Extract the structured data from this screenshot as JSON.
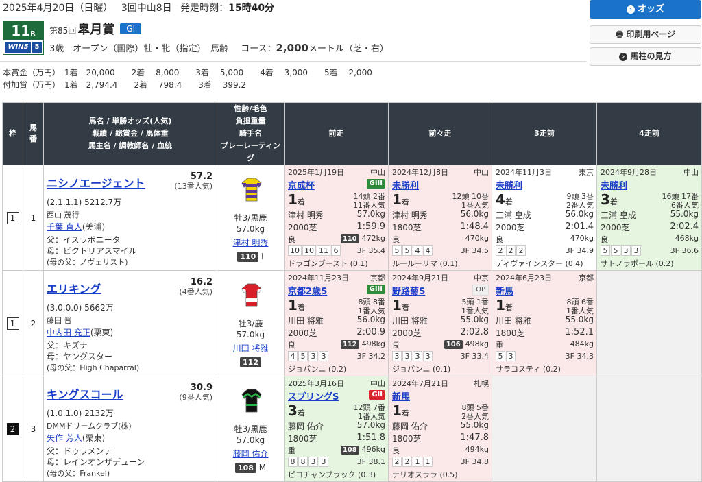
{
  "header": {
    "date": "2025年4月20日（日曜）",
    "meet": "3回中山8日",
    "post_label": "発走時刻：",
    "post_time": "15時40分",
    "race_no": "11",
    "race_no_suffix": "R",
    "logo_text": "WIN5",
    "logo_num": "5",
    "kai": "第85回",
    "race_name": "皐月賞",
    "grade": "GI",
    "conditions": "3歳　オープン（国際）牡・牝（指定）　馬齢",
    "course_label": "コース：",
    "distance": "2,000",
    "distance_unit": "メートル（芝・右）",
    "prize_main": "本賞金（万円）　1着　20,000　　2着　 8,000　　3着　 5,000　　4着　 3,000　　5着　 2,000",
    "prize_add": "付加賞（万円）　1着　2,794.4　　2着　 798.4　　3着　 399.2"
  },
  "buttons": {
    "odds": "オッズ",
    "print": "印刷用ページ",
    "howto": "馬柱の見方"
  },
  "table": {
    "headers": {
      "waku": "枠",
      "uma": "馬番",
      "horse": [
        "馬名 / 単勝オッズ(人気)",
        "戦績 / 総賞金 / 馬体重",
        "馬主名 / 調教師名 / 血統"
      ],
      "jockey": [
        "性齢/毛色",
        "負担重量",
        "騎手名",
        "プレーレーティング"
      ],
      "p1": "前走",
      "p2": "前々走",
      "p3": "3走前",
      "p4": "4走前"
    },
    "rows": [
      {
        "waku": "1",
        "uma": "1",
        "name": "ニシノエージェント",
        "odds": "57.2",
        "pop": "(13番人気)",
        "record": "(2.1.1.1)  5212.7万",
        "owner": "西山 茂行",
        "trainer": "千葉 直人",
        "stable": "(美浦)",
        "sire": "父：イスラボニータ",
        "dam": "母：ビクトリアスマイル",
        "damsire": "(母の父：ノヴェリスト)",
        "sex": "牡3/黒鹿",
        "weight": "57.0kg",
        "jockey": "津村 明秀",
        "rating": "110",
        "rating_suffix": "I",
        "past": [
          {
            "date": "2025年1月19日",
            "venue": "中山",
            "race": "京成杯",
            "grade": "GIII",
            "rank": "1",
            "heads": "14頭 2番",
            "pop": "11番人気",
            "jockey": "津村 明秀",
            "wt": "57.0kg",
            "course": "2000芝",
            "time": "1:59.9",
            "track": "良",
            "rating": "110",
            "bw": "472kg",
            "corners": [
              "10",
              "10",
              "11",
              "6"
            ],
            "f3": "3F 35.4",
            "winner": "ドラゴンブースト (0.1)"
          },
          {
            "date": "2024年12月8日",
            "venue": "中山",
            "race": "未勝利",
            "grade": "",
            "rank": "1",
            "heads": "12頭 10番",
            "pop": "1番人気",
            "jockey": "津村 明秀",
            "wt": "56.0kg",
            "course": "1800芝",
            "time": "1:48.4",
            "track": "良",
            "rating": "",
            "bw": "470kg",
            "corners": [
              "5",
              "5",
              "4",
              "4"
            ],
            "f3": "3F 34.5",
            "winner": "ルールーリマ (0.1)"
          },
          {
            "date": "2024年11月3日",
            "venue": "東京",
            "race": "未勝利",
            "grade": "",
            "rank": "4",
            "heads": "9頭 3番",
            "pop": "2番人気",
            "jockey": "三浦 皇成",
            "wt": "56.0kg",
            "course": "2000芝",
            "time": "2:01.4",
            "track": "良",
            "rating": "",
            "bw": "470kg",
            "corners": [
              "2",
              "2",
              "2"
            ],
            "f3": "3F 34.9",
            "winner": "ディヴァインスター (0.4)"
          },
          {
            "date": "2024年9月28日",
            "venue": "中山",
            "race": "未勝利",
            "grade": "",
            "rank": "3",
            "heads": "16頭 17番",
            "pop": "6番人気",
            "jockey": "三浦 皇成",
            "wt": "55.0kg",
            "course": "2000芝",
            "time": "2:02.4",
            "track": "良",
            "rating": "",
            "bw": "468kg",
            "corners": [
              "5",
              "5",
              "3",
              "3"
            ],
            "f3": "3F 36.6",
            "winner": "サトノラポール (0.2)"
          }
        ]
      },
      {
        "waku": "1",
        "uma": "2",
        "name": "エリキング",
        "odds": "16.2",
        "pop": "(4番人気)",
        "record": "(3.0.0.0)  5662万",
        "owner": "藤田 晋",
        "trainer": "中内田 充正",
        "stable": "(栗東)",
        "sire": "父：キズナ",
        "dam": "母：ヤングスター",
        "damsire": "(母の父：High Chaparral)",
        "sex": "牡3/鹿",
        "weight": "57.0kg",
        "jockey": "川田 将雅",
        "rating": "112",
        "rating_suffix": "",
        "past": [
          {
            "date": "2024年11月23日",
            "venue": "京都",
            "race": "京都2歳S",
            "grade": "GIII",
            "rank": "1",
            "heads": "8頭 8番",
            "pop": "1番人気",
            "jockey": "川田 将雅",
            "wt": "56.0kg",
            "course": "2000芝",
            "time": "2:00.9",
            "track": "良",
            "rating": "112",
            "bw": "498kg",
            "corners": [
              "4",
              "5",
              "3",
              "3"
            ],
            "f3": "3F 34.2",
            "winner": "ジョバンニ (0.2)"
          },
          {
            "date": "2024年9月21日",
            "venue": "中京",
            "race": "野路菊S",
            "grade": "OP",
            "rank": "1",
            "heads": "5頭 1番",
            "pop": "1番人気",
            "jockey": "川田 将雅",
            "wt": "55.0kg",
            "course": "2000芝",
            "time": "2:02.8",
            "track": "良",
            "rating": "106",
            "bw": "498kg",
            "corners": [
              "3",
              "3",
              "3",
              "3"
            ],
            "f3": "3F 33.4",
            "winner": "ジョバンニ (0.1)"
          },
          {
            "date": "2024年6月23日",
            "venue": "京都",
            "race": "新馬",
            "grade": "",
            "rank": "1",
            "heads": "8頭 6番",
            "pop": "1番人気",
            "jockey": "川田 将雅",
            "wt": "55.0kg",
            "course": "1800芝",
            "time": "1:52.1",
            "track": "重",
            "rating": "",
            "bw": "484kg",
            "corners": [
              "5",
              "3"
            ],
            "f3": "3F 34.3",
            "winner": "サラコスティ (0.2)"
          }
        ]
      },
      {
        "waku": "2",
        "uma": "3",
        "name": "キングスコール",
        "odds": "30.9",
        "pop": "(9番人気)",
        "record": "(1.0.1.0)  2132万",
        "owner": "DMMドリームクラブ(株)",
        "trainer": "矢作 芳人",
        "stable": "(栗東)",
        "sire": "父：ドゥラメンテ",
        "dam": "母：レインオンザデューン",
        "damsire": "(母の父：Frankel)",
        "sex": "牡3/黒鹿",
        "weight": "57.0kg",
        "jockey": "藤岡 佑介",
        "rating": "108",
        "rating_suffix": "M",
        "past": [
          {
            "date": "2025年3月16日",
            "venue": "中山",
            "race": "スプリングS",
            "grade": "GII",
            "rank": "3",
            "heads": "12頭 7番",
            "pop": "1番人気",
            "jockey": "藤岡 佑介",
            "wt": "57.0kg",
            "course": "1800芝",
            "time": "1:51.8",
            "track": "重",
            "rating": "108",
            "bw": "496kg",
            "corners": [
              "8",
              "8",
              "3",
              "3"
            ],
            "f3": "3F 38.1",
            "winner": "ピコチャンブラック (0.3)"
          },
          {
            "date": "2024年7月21日",
            "venue": "札幌",
            "race": "新馬",
            "grade": "",
            "rank": "1",
            "heads": "8頭 5番",
            "pop": "2番人気",
            "jockey": "藤岡 佑介",
            "wt": "55.0kg",
            "course": "1800芝",
            "time": "1:47.8",
            "track": "良",
            "rating": "",
            "bw": "494kg",
            "corners": [
              "2",
              "2",
              "1",
              "1"
            ],
            "f3": "3F 34.8",
            "winner": "テリオスララ (0.5)"
          }
        ]
      }
    ],
    "rank_suffix": "着"
  },
  "colors": {
    "header_bg": "#333c45",
    "accent_blue": "#1a73c8",
    "win_pink": "#fbe9ea",
    "place_green": "#e6f5e0",
    "grade3": "#2e8b3a",
    "grade2": "#d9262c"
  }
}
